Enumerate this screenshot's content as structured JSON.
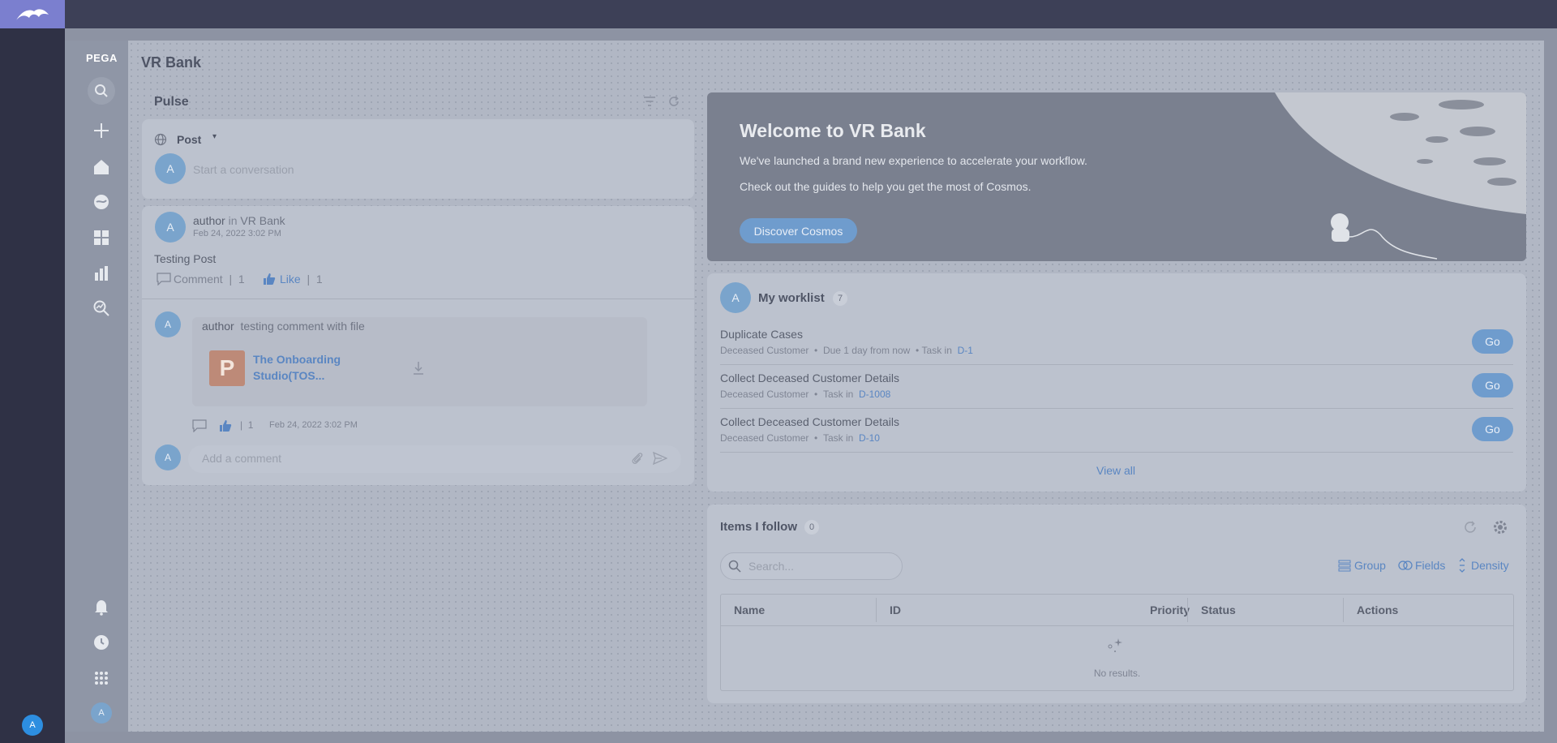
{
  "app": {
    "brand": "PEGA",
    "title": "VR Bank",
    "user_initial": "A"
  },
  "nav": {
    "items": [
      "search-icon",
      "plus-icon",
      "home-icon",
      "globe-icon",
      "grid-icon",
      "chart-icon",
      "explore-icon",
      "bell-icon",
      "clock-icon",
      "apps-icon"
    ]
  },
  "pulse": {
    "title": "Pulse",
    "post_type": "Post",
    "input_placeholder": "Start a conversation",
    "post": {
      "author": "author",
      "in_label": "in",
      "space": "VR Bank",
      "timestamp": "Feb 24, 2022 3:02 PM",
      "body": "Testing Post",
      "comment_label": "Comment",
      "comment_sep": "|",
      "comment_count": "1",
      "like_label": "Like",
      "like_sep": "|",
      "like_count": "1"
    },
    "comment": {
      "author": "author",
      "text": "testing comment with file",
      "file_letter": "P",
      "file_name_line1": "The Onboarding",
      "file_name_line2": "Studio(TOS...",
      "like_sep": "|",
      "like_count": "1",
      "timestamp": "Feb 24, 2022 3:02 PM"
    },
    "add_comment_placeholder": "Add a comment"
  },
  "welcome": {
    "title": "Welcome to VR Bank",
    "line1": "We've launched a brand new experience to accelerate your workflow.",
    "line2": "Check out the guides to help you get the most of Cosmos.",
    "button": "Discover Cosmos"
  },
  "worklist": {
    "title": "My worklist",
    "count": "7",
    "items": [
      {
        "title": "Duplicate Cases",
        "customer": "Deceased Customer",
        "due": "Due 1 day from now",
        "task_label": "Task in",
        "case_id": "D-1",
        "button": "Go"
      },
      {
        "title": "Collect Deceased Customer Details",
        "customer": "Deceased Customer",
        "task_label": "Task in",
        "case_id": "D-1008",
        "button": "Go"
      },
      {
        "title": "Collect Deceased Customer Details",
        "customer": "Deceased Customer",
        "task_label": "Task in",
        "case_id": "D-10",
        "button": "Go"
      }
    ],
    "view_all": "View all"
  },
  "follow": {
    "title": "Items I follow",
    "count": "0",
    "search_placeholder": "Search...",
    "tools": {
      "group": "Group",
      "fields": "Fields",
      "density": "Density"
    },
    "columns": [
      "Name",
      "ID",
      "Priority",
      "Status",
      "Actions"
    ],
    "empty_text": "No results."
  }
}
